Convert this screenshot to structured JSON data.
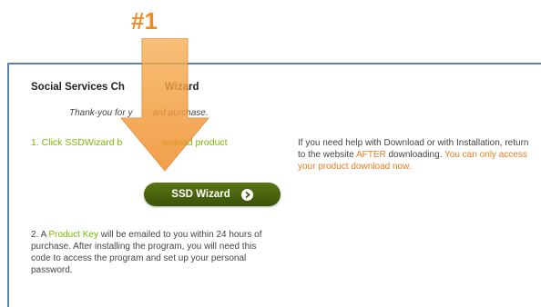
{
  "annotation": {
    "step_label": "#1",
    "arrow_color": "#f5a13c"
  },
  "wizard": {
    "title": "Social Services Ch",
    "title_end": "Wizard",
    "thanks": "Thank-you for y",
    "thanks_end": "ard purchase.",
    "step1": "1. Click SSDWizard b",
    "step1_end": "wnload product"
  },
  "help": {
    "text1": "If you need help with Download or with Installation, return to the website ",
    "after": "AFTER",
    "text2": " downloading. ",
    "only": "You can only access your product download now."
  },
  "button": {
    "label": "SSD Wizard",
    "icon": "play-icon"
  },
  "step2": {
    "prefix": "2. A ",
    "product_key": "Product Key",
    "rest": " will be emailed to you within 24 hours of purchase. After installing the program, you will need this code to access the program and set up your personal password."
  },
  "colors": {
    "border": "#5b83b8",
    "green": "#7ab800",
    "orange": "#e87d1e",
    "button": "#4a6410"
  }
}
